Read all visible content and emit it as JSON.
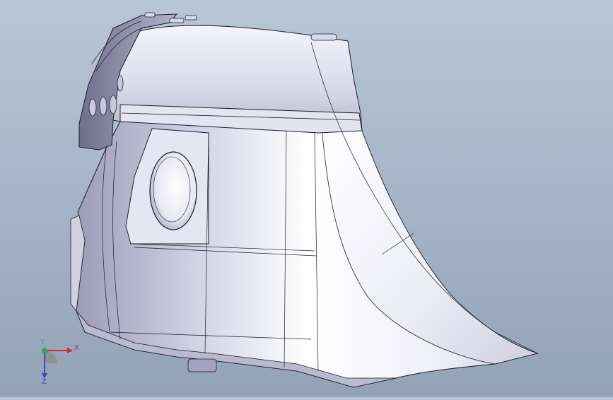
{
  "viewport": {
    "background_top": "#b9c6d6",
    "background_bottom": "#93a3b6",
    "model": {
      "shade_light": "#ffffff",
      "shade_mid": "#d6d6ea",
      "shade_dark": "#8b8ba6",
      "edge_color": "#1b1b2a"
    }
  },
  "triad": {
    "x_label": "X",
    "y_label": "Y",
    "z_label": "Z",
    "x_color": "#d9262c",
    "y_color": "#22b14c",
    "z_color": "#3b45d1"
  }
}
